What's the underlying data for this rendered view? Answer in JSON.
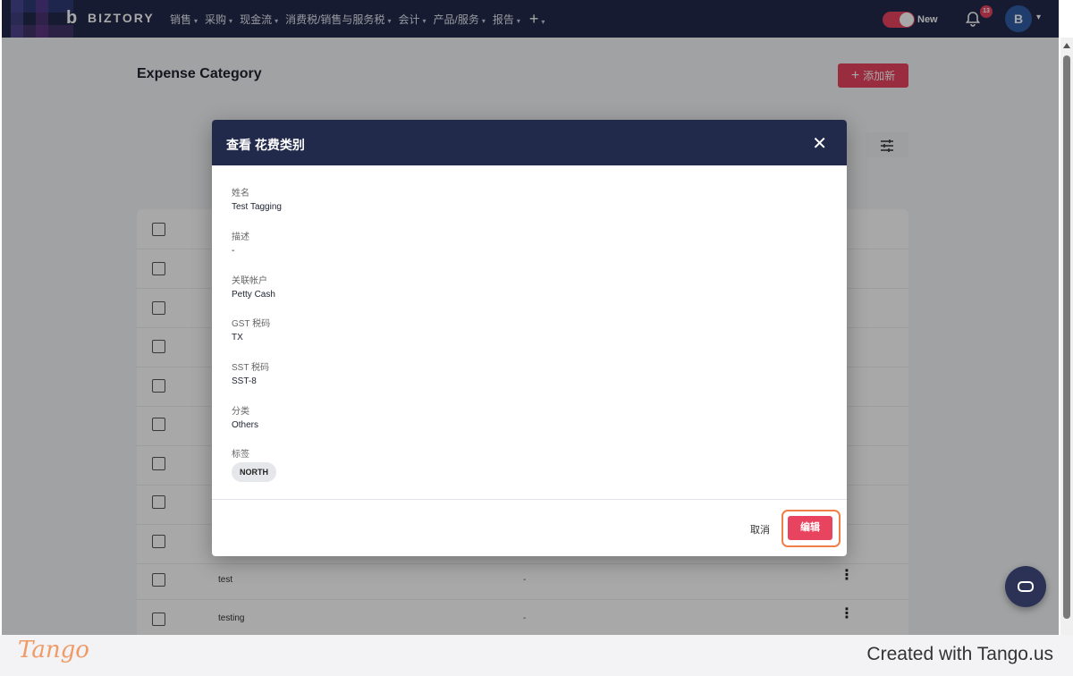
{
  "nav": {
    "brand": "BIZTORY",
    "menu": [
      "销售",
      "采购",
      "现金流",
      "消费税/销售与服务税",
      "会计",
      "产品/服务",
      "报告"
    ],
    "plus": "+",
    "toggle_label": "New",
    "notification_count": "13",
    "avatar_initial": "B"
  },
  "page": {
    "title": "Expense Category",
    "add_button": "添加新"
  },
  "table": {
    "rows": [
      {
        "name": "test",
        "description": "-"
      },
      {
        "name": "testing",
        "description": "-"
      }
    ]
  },
  "modal": {
    "title": "查看 花费类别",
    "close": "✕",
    "fields": [
      {
        "label": "姓名",
        "value": "Test Tagging"
      },
      {
        "label": "描述",
        "value": "-"
      },
      {
        "label": "关联帐户",
        "value": "Petty Cash"
      },
      {
        "label": "GST 税码",
        "value": "TX"
      },
      {
        "label": "SST 税码",
        "value": "SST-8"
      },
      {
        "label": "分类",
        "value": "Others"
      }
    ],
    "tags_label": "标签",
    "tags": [
      "NORTH"
    ],
    "cancel": "取消",
    "edit": "编辑"
  },
  "footer": {
    "logo": "Tango",
    "created": "Created with Tango.us"
  },
  "colors": {
    "nav_bg": "#222a4b",
    "accent": "#e8445f",
    "highlight": "#f07f47"
  }
}
